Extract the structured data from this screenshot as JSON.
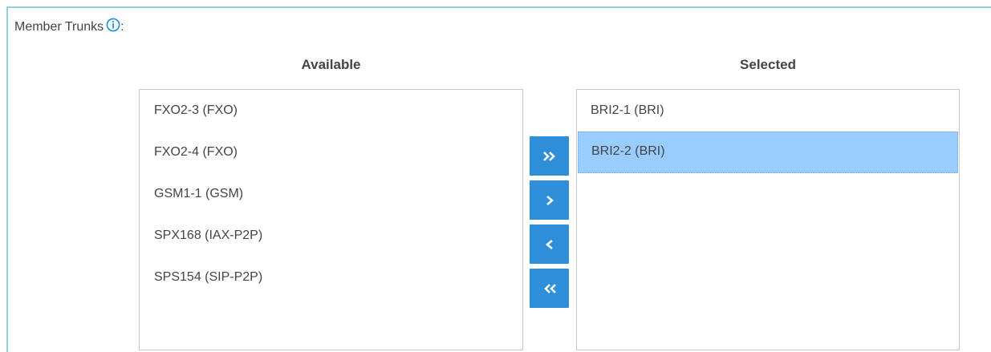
{
  "section": {
    "label": "Member Trunks",
    "suffix": ":",
    "info_icon": "info-circle-icon"
  },
  "available": {
    "header": "Available",
    "items": [
      {
        "label": "FXO2-3 (FXO)"
      },
      {
        "label": "FXO2-4 (FXO)"
      },
      {
        "label": "GSM1-1 (GSM)"
      },
      {
        "label": "SPX168 (IAX-P2P)"
      },
      {
        "label": "SPS154 (SIP-P2P)"
      }
    ]
  },
  "selected": {
    "header": "Selected",
    "items": [
      {
        "label": "BRI2-1 (BRI)",
        "highlighted": false
      },
      {
        "label": "BRI2-2 (BRI)",
        "highlighted": true
      }
    ]
  },
  "buttons": {
    "add_all": {
      "icon": "double-chevron-right-icon",
      "glyph": "»"
    },
    "add": {
      "icon": "chevron-right-icon",
      "glyph": "›"
    },
    "remove": {
      "icon": "chevron-left-icon",
      "glyph": "‹"
    },
    "remove_all": {
      "icon": "double-chevron-left-icon",
      "glyph": "«"
    }
  },
  "colors": {
    "accent": "#2e8ed8",
    "selection": "#99ccff",
    "panel_border": "#8fd3e0"
  }
}
